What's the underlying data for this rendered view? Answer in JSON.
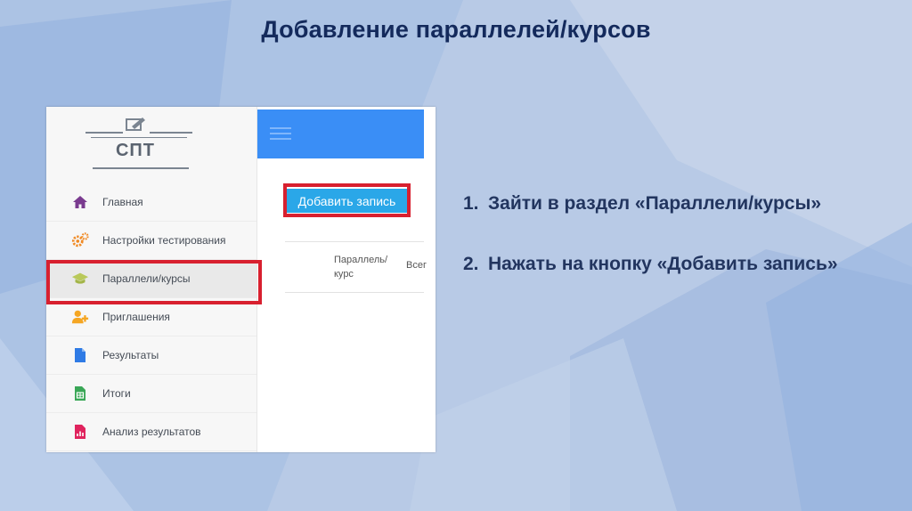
{
  "slide": {
    "title": "Добавление параллелей/курсов",
    "steps": [
      {
        "num": "1.",
        "text": "Зайти в раздел «Параллели/курсы»"
      },
      {
        "num": "2.",
        "text": "Нажать на кнопку «Добавить запись»"
      }
    ]
  },
  "app": {
    "logo_text": "СПТ",
    "nav": [
      {
        "label": "Главная",
        "icon": "home-icon"
      },
      {
        "label": "Настройки тестирования",
        "icon": "gears-icon"
      },
      {
        "label": "Параллели/курсы",
        "icon": "graduation-cap-icon",
        "active": true
      },
      {
        "label": "Приглашения",
        "icon": "add-user-icon"
      },
      {
        "label": "Результаты",
        "icon": "document-icon"
      },
      {
        "label": "Итоги",
        "icon": "spreadsheet-icon"
      },
      {
        "label": "Анализ результатов",
        "icon": "chart-file-icon"
      }
    ],
    "add_button_label": "Добавить запись",
    "table_headers": [
      "Параллель/ курс",
      "Всег"
    ]
  },
  "colors": {
    "title": "#142a5c",
    "topbar": "#3a8ef6",
    "button": "#2aa7e8",
    "highlight": "#d8202f"
  }
}
